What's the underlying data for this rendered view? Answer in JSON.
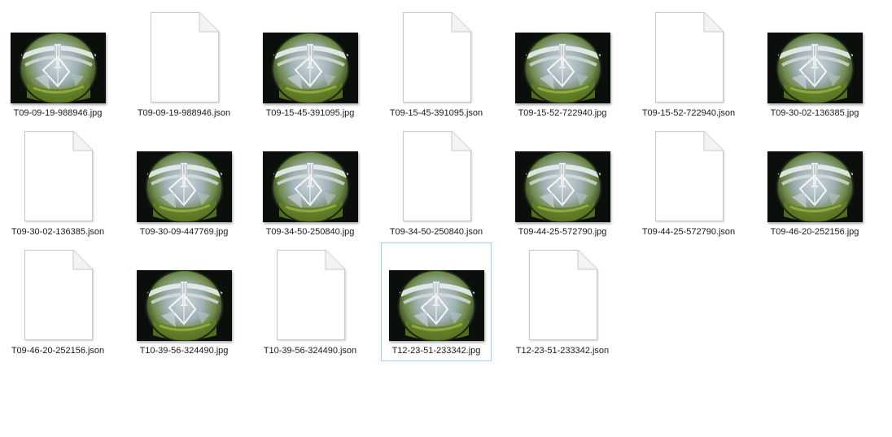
{
  "files": [
    {
      "name": "T09-09-19-988946.jpg",
      "type": "image",
      "icon": "fisheye-photo-thumbnail",
      "selected": false
    },
    {
      "name": "T09-09-19-988946.json",
      "type": "json",
      "icon": "blank-document-icon",
      "selected": false
    },
    {
      "name": "T09-15-45-391095.jpg",
      "type": "image",
      "icon": "fisheye-photo-thumbnail",
      "selected": false
    },
    {
      "name": "T09-15-45-391095.json",
      "type": "json",
      "icon": "blank-document-icon",
      "selected": false
    },
    {
      "name": "T09-15-52-722940.jpg",
      "type": "image",
      "icon": "fisheye-photo-thumbnail",
      "selected": false
    },
    {
      "name": "T09-15-52-722940.json",
      "type": "json",
      "icon": "blank-document-icon",
      "selected": false
    },
    {
      "name": "T09-30-02-136385.jpg",
      "type": "image",
      "icon": "fisheye-photo-thumbnail",
      "selected": false
    },
    {
      "name": "T09-30-02-136385.json",
      "type": "json",
      "icon": "blank-document-icon",
      "selected": false
    },
    {
      "name": "T09-30-09-447769.jpg",
      "type": "image",
      "icon": "fisheye-photo-thumbnail",
      "selected": false
    },
    {
      "name": "T09-34-50-250840.jpg",
      "type": "image",
      "icon": "fisheye-photo-thumbnail",
      "selected": false
    },
    {
      "name": "T09-34-50-250840.json",
      "type": "json",
      "icon": "blank-document-icon",
      "selected": false
    },
    {
      "name": "T09-44-25-572790.jpg",
      "type": "image",
      "icon": "fisheye-photo-thumbnail",
      "selected": false
    },
    {
      "name": "T09-44-25-572790.json",
      "type": "json",
      "icon": "blank-document-icon",
      "selected": false
    },
    {
      "name": "T09-46-20-252156.jpg",
      "type": "image",
      "icon": "fisheye-photo-thumbnail",
      "selected": false
    },
    {
      "name": "T09-46-20-252156.json",
      "type": "json",
      "icon": "blank-document-icon",
      "selected": false
    },
    {
      "name": "T10-39-56-324490.jpg",
      "type": "image",
      "icon": "fisheye-photo-thumbnail",
      "selected": false
    },
    {
      "name": "T10-39-56-324490.json",
      "type": "json",
      "icon": "blank-document-icon",
      "selected": false
    },
    {
      "name": "T12-23-51-233342.jpg",
      "type": "image",
      "icon": "fisheye-photo-thumbnail",
      "selected": true
    },
    {
      "name": "T12-23-51-233342.json",
      "type": "json",
      "icon": "blank-document-icon",
      "selected": false
    }
  ],
  "colors": {
    "selection_border": "#99d1ff",
    "label_text": "#1a1a1a",
    "document_page": "#ffffff",
    "document_border": "#c8c8c8",
    "photo_sky": "#9fb2b8",
    "photo_grass": "#6a8a2a"
  }
}
